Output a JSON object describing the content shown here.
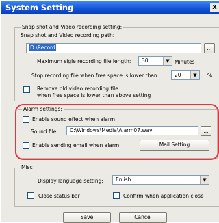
{
  "window": {
    "title": "System Setting",
    "close_glyph": "x"
  },
  "recording": {
    "group_label": "Snap shot and Video recording setting:",
    "path_label": "Snap shot and Video recording path:",
    "path_value": "D:\\Record",
    "browse_label": "...",
    "max_length_label": "Maximum sigle recording file length:",
    "max_length_value": "30",
    "minutes_unit": "Minutes",
    "stop_label": "Stop recording file when free space is lower than",
    "stop_value": "20",
    "percent_unit": "%",
    "remove_line1": "Remove old video recording file",
    "remove_line2": "when free space is lower than above setting"
  },
  "alarm": {
    "group_label": "Alarm settings:",
    "enable_sound_label": "Enable sound effect when alarm",
    "sound_file_label": "Sound file",
    "sound_file_value": "C:\\Windows\\Media\\Alarm07.wav",
    "browse_label": "...",
    "enable_email_label": "Enable sending email when alarm",
    "mail_button": "Mail Setting"
  },
  "misc": {
    "group_label": "Misc",
    "language_label": "Display language setting:",
    "language_value": "Enlish",
    "close_status_label": "Close status bar",
    "confirm_close_label": "Confirm when application close"
  },
  "footer": {
    "save": "Save",
    "cancel": "Cancel"
  },
  "colors": {
    "title_bar": "#1452d6",
    "highlight_ring": "#e8323c",
    "selection": "#316ac5"
  },
  "icons": {
    "dropdown": "triangle-down"
  }
}
